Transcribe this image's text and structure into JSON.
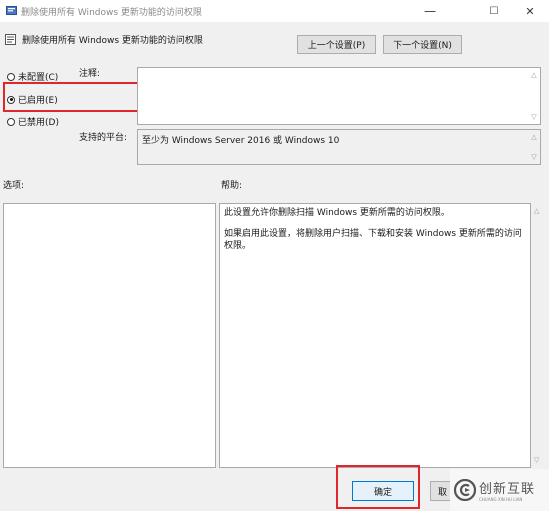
{
  "window": {
    "title": "删除使用所有 Windows 更新功能的访问权限",
    "minimize_glyph": "—",
    "maximize_glyph": "☐",
    "close_glyph": "✕"
  },
  "header": {
    "policy_name": "删除使用所有 Windows 更新功能的访问权限",
    "prev_button": "上一个设置(P)",
    "next_button": "下一个设置(N)"
  },
  "state": {
    "options": [
      {
        "label": "未配置(C)",
        "checked": false
      },
      {
        "label": "已启用(E)",
        "checked": true
      },
      {
        "label": "已禁用(D)",
        "checked": false
      }
    ]
  },
  "comment": {
    "label": "注释:",
    "value": ""
  },
  "platform": {
    "label": "支持的平台:",
    "value": "至少为 Windows Server 2016 或 Windows 10"
  },
  "options_section": {
    "label": "选项:"
  },
  "help_section": {
    "label": "帮助:",
    "paragraphs": [
      "此设置允许你删除扫描 Windows 更新所需的访问权限。",
      "如果启用此设置，将删除用户扫描、下载和安装 Windows 更新所需的访问权限。"
    ]
  },
  "footer": {
    "ok_button": "确定",
    "cancel_button": "取"
  },
  "watermark": {
    "name": "创新互联",
    "sub": "CHUANG XIN HU LIAN"
  },
  "colors": {
    "highlight": "#e0262b",
    "background": "#f0f0f0"
  }
}
